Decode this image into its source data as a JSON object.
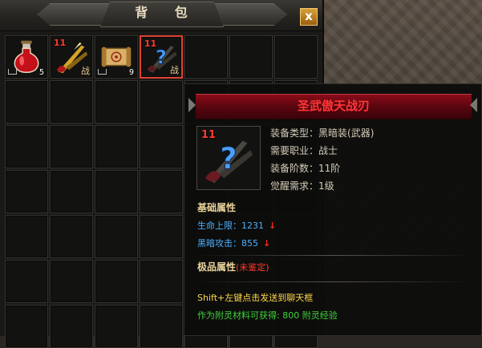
{
  "window": {
    "title": "背 包",
    "close_glyph": "x"
  },
  "inventory": {
    "columns": 7,
    "rows": 7,
    "slots": [
      {
        "item": "red-potion",
        "count": "5",
        "bound": true
      },
      {
        "item": "warrior-blade",
        "level": "11",
        "class_tag": "战"
      },
      {
        "item": "scroll",
        "count": "9",
        "bound": true
      },
      {
        "item": "unidentified-blade",
        "level": "11",
        "class_tag": "战",
        "selected": true
      }
    ]
  },
  "tooltip": {
    "name": "圣武傲天战刃",
    "icon_level": "11",
    "stats": [
      {
        "label": "装备类型：",
        "value": "黑暗装(武器)"
      },
      {
        "label": "需要职业：",
        "value": "战士"
      },
      {
        "label": "装备阶数：",
        "value": "11阶"
      },
      {
        "label": "觉醒需求：",
        "value": "1级"
      }
    ],
    "base_section": "基础属性",
    "base_attrs": [
      {
        "label": "生命上限：",
        "value": "1231",
        "arrow": "↓"
      },
      {
        "label": "黑暗攻击：",
        "value": "855",
        "arrow": "↓"
      }
    ],
    "premium_section": "极品属性",
    "premium_status": "(未鉴定)",
    "hint_chat": "Shift+左键点击发送到聊天框",
    "hint_spirit": "作为附灵材料可获得: 800 附灵经验"
  },
  "colors": {
    "title_red": "#ff3636",
    "attr_blue": "#4fb1ff",
    "hint_yellow": "#ffd84a",
    "hint_green": "#3ed23a",
    "section_gold": "#ead39a",
    "selected_border": "#e0412f"
  }
}
